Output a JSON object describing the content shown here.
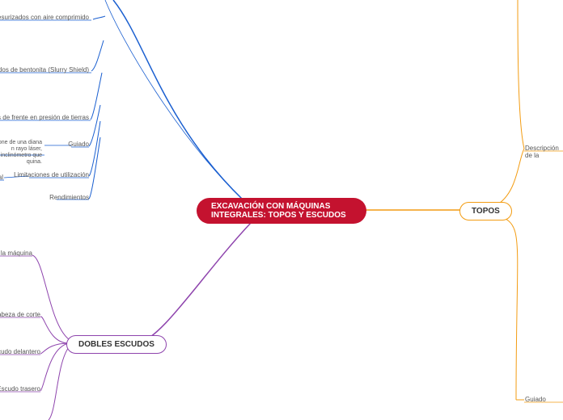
{
  "center": {
    "title": "EXCAVACIÓN CON MÁQUINAS INTEGRALES: TOPOS Y ESCUDOS"
  },
  "right": {
    "topos": {
      "label": "TOPOS"
    },
    "descripcion": "Descripción de la",
    "guiado": "Guiado"
  },
  "left": {
    "dobles": {
      "label": "DOBLES ESCUDOS"
    },
    "items": {
      "aire": "scudos presurizados con aire comprimido",
      "bentonita": "o escudos de bentonita (Slurry Shield)",
      "presion": "Escudos de frente en presión de tierras",
      "guiadoDesc": "pone de una diana\nn rayo láser,\nn inclinómetro que\nquina.",
      "guiado": "Guiado",
      "limitaciones": "Limitaciones de utilización",
      "al": "al",
      "rendimientos": "Rendimientos",
      "descMaquina": "ión de la máquina",
      "cabeza": "Cabeza de corte",
      "delantero": "Escudo delantero",
      "trasero": "Escudo trasero"
    }
  }
}
